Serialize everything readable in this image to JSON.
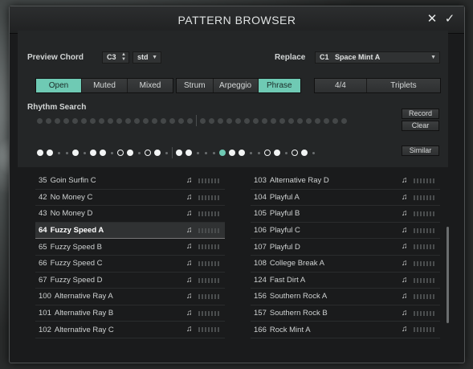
{
  "window": {
    "title": "PATTERN BROWSER",
    "close": "✕",
    "confirm": "✓"
  },
  "preview": {
    "label": "Preview Chord",
    "note": "C3",
    "mode": "std"
  },
  "replace": {
    "label": "Replace",
    "slot": "C1",
    "value": "Space Mint A"
  },
  "filters": {
    "articulation": [
      "Open",
      "Muted",
      "Mixed"
    ],
    "articulation_selected": "Open",
    "style": [
      "Strum",
      "Arpeggio",
      "Phrase"
    ],
    "style_selected": "Phrase",
    "time": [
      "4/4",
      "Triplets"
    ]
  },
  "rhythm": {
    "label": "Rhythm Search",
    "record": "Record",
    "clear": "Clear",
    "similar": "Similar"
  },
  "patterns_left": [
    {
      "num": "35",
      "name": "Goin Surfin C"
    },
    {
      "num": "42",
      "name": "No Money C"
    },
    {
      "num": "43",
      "name": "No Money D"
    },
    {
      "num": "64",
      "name": "Fuzzy Speed A"
    },
    {
      "num": "65",
      "name": "Fuzzy Speed B"
    },
    {
      "num": "66",
      "name": "Fuzzy Speed C"
    },
    {
      "num": "67",
      "name": "Fuzzy Speed D"
    },
    {
      "num": "100",
      "name": "Alternative Ray A"
    },
    {
      "num": "101",
      "name": "Alternative Ray B"
    },
    {
      "num": "102",
      "name": "Alternative Ray C"
    }
  ],
  "patterns_right": [
    {
      "num": "103",
      "name": "Alternative Ray D"
    },
    {
      "num": "104",
      "name": "Playful A"
    },
    {
      "num": "105",
      "name": "Playful B"
    },
    {
      "num": "106",
      "name": "Playful C"
    },
    {
      "num": "107",
      "name": "Playful D"
    },
    {
      "num": "108",
      "name": "College Break A"
    },
    {
      "num": "124",
      "name": "Fast Dirt A"
    },
    {
      "num": "156",
      "name": "Southern Rock A"
    },
    {
      "num": "157",
      "name": "Southern Rock B"
    },
    {
      "num": "166",
      "name": "Rock Mint A"
    }
  ],
  "selected_pattern": "64",
  "icons": {
    "note": "music-note-icon"
  },
  "colors": {
    "accent": "#6fcab4",
    "panel": "#242627",
    "window": "#1a1b1c"
  }
}
